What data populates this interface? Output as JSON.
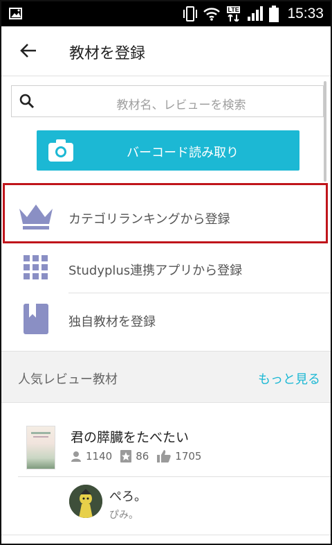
{
  "status_bar": {
    "time": "15:33",
    "network": "LTE"
  },
  "app_bar": {
    "title": "教材を登録"
  },
  "search": {
    "placeholder": "教材名、レビューを検索"
  },
  "barcode_button": {
    "label": "バーコード読み取り"
  },
  "menu": {
    "items": [
      {
        "label": "カテゴリランキングから登録",
        "icon": "crown-icon"
      },
      {
        "label": "Studyplus連携アプリから登録",
        "icon": "grid-icon"
      },
      {
        "label": "独自教材を登録",
        "icon": "bookmark-book-icon"
      }
    ]
  },
  "popular": {
    "title": "人気レビュー教材",
    "more_label": "もっと見る"
  },
  "book": {
    "name": "君の膵臓をたべたい",
    "users": "1140",
    "reviews": "86",
    "likes": "1705"
  },
  "review": {
    "name": "ぺろ。",
    "text": "ぴみ。"
  },
  "colors": {
    "accent": "#1cb8d4",
    "icon": "#8a8fc4",
    "highlight": "#c0151b"
  }
}
